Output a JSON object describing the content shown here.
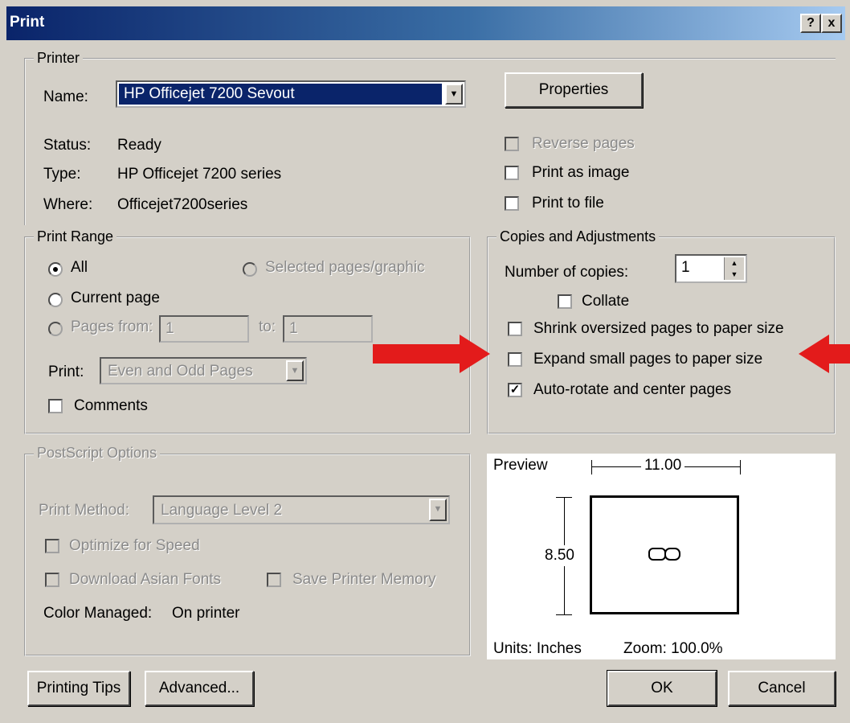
{
  "window": {
    "title": "Print",
    "help_btn": "?",
    "close_btn": "x"
  },
  "printer": {
    "legend": "Printer",
    "name_label": "Name:",
    "name_value": "HP Officejet 7200 Sevout",
    "status_label": "Status:",
    "status_value": "Ready",
    "type_label": "Type:",
    "type_value": "HP Officejet 7200 series",
    "where_label": "Where:",
    "where_value": "Officejet7200series",
    "properties_btn": "Properties",
    "reverse_pages": "Reverse pages",
    "print_as_image": "Print as image",
    "print_to_file": "Print to file"
  },
  "print_range": {
    "legend": "Print Range",
    "all": "All",
    "selected": "Selected pages/graphic",
    "current_page": "Current page",
    "pages_from": "Pages from:",
    "from_value": "1",
    "to_label": "to:",
    "to_value": "1",
    "print_label": "Print:",
    "print_value": "Even and Odd Pages",
    "comments": "Comments"
  },
  "copies": {
    "legend": "Copies and Adjustments",
    "num_label": "Number of copies:",
    "num_value": "1",
    "collate": "Collate",
    "shrink": "Shrink oversized pages to paper size",
    "expand": "Expand small pages to paper size",
    "autorotate": "Auto-rotate and center pages",
    "accent": "#e31b1b"
  },
  "postscript": {
    "legend": "PostScript Options",
    "method_label": "Print Method:",
    "method_value": "Language Level 2",
    "optimize": "Optimize for Speed",
    "download_fonts": "Download Asian Fonts",
    "save_memory": "Save Printer Memory",
    "color_managed_label": "Color Managed:",
    "color_managed_value": "On printer"
  },
  "preview": {
    "label": "Preview",
    "width": "11.00",
    "height": "8.50",
    "units": "Units: Inches",
    "zoom": "Zoom: 100.0%"
  },
  "buttons": {
    "tips": "Printing Tips",
    "advanced": "Advanced...",
    "ok": "OK",
    "cancel": "Cancel"
  }
}
